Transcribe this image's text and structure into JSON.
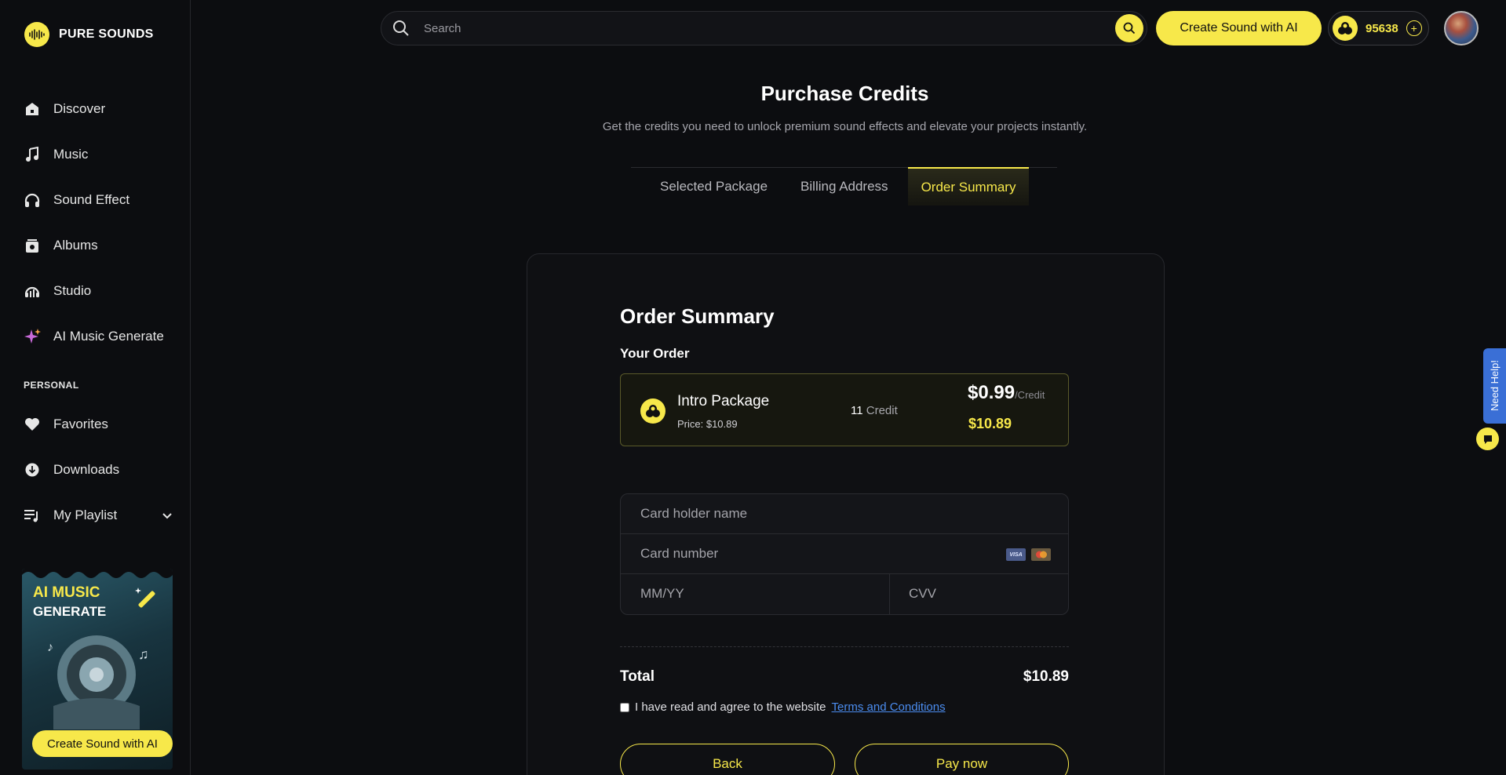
{
  "brand": {
    "name": "PURE SOUNDS"
  },
  "nav": {
    "items": [
      {
        "label": "Discover",
        "icon": "home-icon"
      },
      {
        "label": "Music",
        "icon": "music-note-icon"
      },
      {
        "label": "Sound Effect",
        "icon": "headphones-icon"
      },
      {
        "label": "Albums",
        "icon": "album-icon"
      },
      {
        "label": "Studio",
        "icon": "studio-icon"
      },
      {
        "label": "AI Music Generate",
        "icon": "sparkle-icon"
      }
    ],
    "personal_label": "PERSONAL",
    "personal": [
      {
        "label": "Favorites",
        "icon": "heart-icon"
      },
      {
        "label": "Downloads",
        "icon": "download-icon"
      },
      {
        "label": "My Playlist",
        "icon": "playlist-icon"
      }
    ]
  },
  "promo": {
    "line1": "AI MUSIC",
    "line2": "GENERATE",
    "button": "Create Sound with AI"
  },
  "topbar": {
    "search_placeholder": "Search",
    "create_button": "Create Sound with AI",
    "credits": "95638"
  },
  "page": {
    "title": "Purchase Credits",
    "subtitle": "Get the credits you need to unlock premium sound effects and elevate your projects instantly.",
    "tabs": [
      "Selected Package",
      "Billing Address",
      "Order Summary"
    ],
    "active_tab": "Order Summary"
  },
  "order": {
    "title": "Order Summary",
    "your_order": "Your Order",
    "package_name": "Intro Package",
    "package_price": "Price: $10.89",
    "credit_count": "11",
    "credit_label": "Credit",
    "unit_price": "$0.99",
    "unit_suffix": "/Credit",
    "package_total": "$10.89"
  },
  "payment": {
    "holder_placeholder": "Card holder name",
    "number_placeholder": "Card number",
    "expiry_placeholder": "MM/YY",
    "cvv_placeholder": "CVV",
    "visa_text": "VISA"
  },
  "total": {
    "label": "Total",
    "value": "$10.89",
    "agree_text": "I have read and agree to the website",
    "terms_link": "Terms and Conditions"
  },
  "actions": {
    "back": "Back",
    "pay": "Pay now"
  },
  "help": {
    "label": "Need Help!"
  },
  "colors": {
    "accent": "#f7e84a",
    "background": "#0c0d10",
    "link": "#4b8df0",
    "help": "#3a6fd6"
  }
}
